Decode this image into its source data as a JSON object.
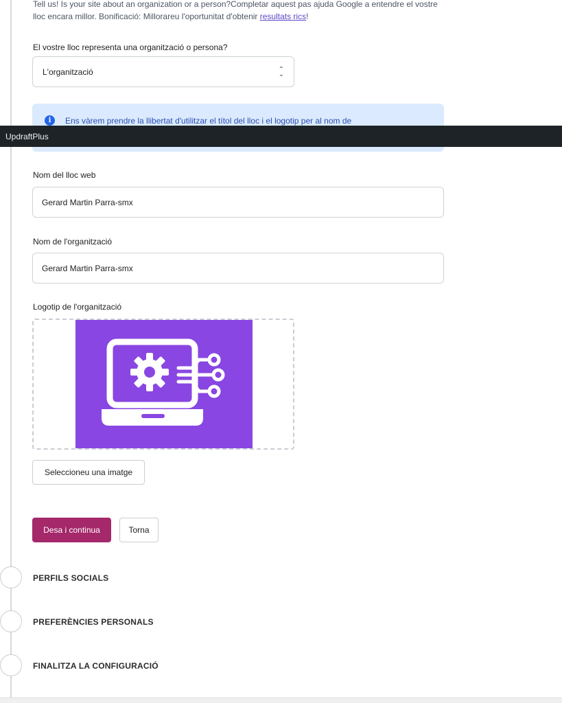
{
  "intro": {
    "text": "Tell us! Is your site about an organization or a person?Completar aquest pas ajuda Google a entendre el vostre lloc encara millor. Bonificació: Millorareu l'oportunitat d'obtenir ",
    "link": "resultats rics",
    "suffix": "!"
  },
  "represent": {
    "label": "El vostre lloc representa una organització o persona?",
    "selected": "L'organització"
  },
  "alert": {
    "text": "Ens vàrem prendre la llibertat d'utilitzar el títol del lloc i el logotip per al nom de"
  },
  "admin_bar": {
    "title": "UpdraftPlus"
  },
  "site_name": {
    "label": "Nom del lloc web",
    "value": "Gerard Martin Parra-smx"
  },
  "org_name": {
    "label": "Nom de l'organització",
    "value": "Gerard Martin Parra-smx"
  },
  "org_logo": {
    "label": "Logotip de l'organització",
    "select_button": "Seleccioneu una imatge"
  },
  "actions": {
    "save": "Desa i continua",
    "back": "Torna"
  },
  "steps": [
    {
      "label": "PERFILS SOCIALS"
    },
    {
      "label": "PREFERÈNCIES PERSONALS"
    },
    {
      "label": "FINALITZA LA CONFIGURACIÓ"
    }
  ],
  "colors": {
    "primary": "#a4286a",
    "alert_bg": "#dbeafe",
    "logo_bg": "#8946e2",
    "admin_bar": "#1d2327"
  }
}
